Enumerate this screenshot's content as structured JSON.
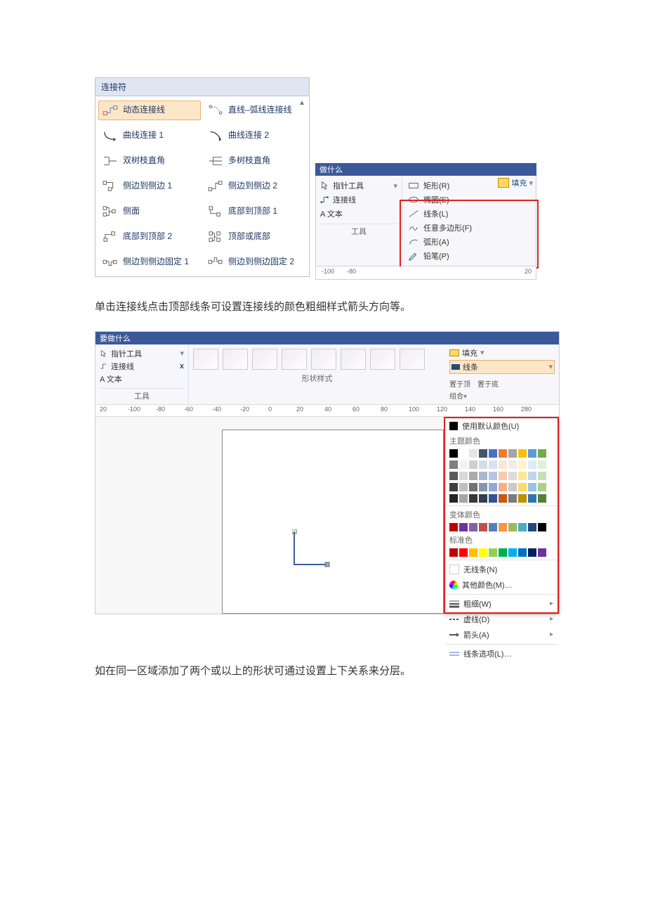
{
  "connectors": {
    "title": "连接符",
    "items": [
      {
        "label": "动态连接线",
        "name": "connector-dynamic",
        "selected": true
      },
      {
        "label": "直线–弧线连接线",
        "name": "connector-line-arc"
      },
      {
        "label": "曲线连接 1",
        "name": "connector-curve-1"
      },
      {
        "label": "曲线连接 2",
        "name": "connector-curve-2"
      },
      {
        "label": "双树枝直角",
        "name": "connector-double-branch"
      },
      {
        "label": "多树枝直角",
        "name": "connector-multi-branch"
      },
      {
        "label": "侧边到侧边 1",
        "name": "connector-side-to-side-1"
      },
      {
        "label": "侧边到侧边 2",
        "name": "connector-side-to-side-2"
      },
      {
        "label": "侧面",
        "name": "connector-side"
      },
      {
        "label": "底部到顶部 1",
        "name": "connector-bottom-top-1"
      },
      {
        "label": "底部到顶部 2",
        "name": "connector-bottom-top-2"
      },
      {
        "label": "顶部或底部",
        "name": "connector-top-or-bottom"
      },
      {
        "label": "侧边到侧边固定 1",
        "name": "connector-side-fixed-1"
      },
      {
        "label": "侧边到侧边固定 2",
        "name": "connector-side-fixed-2"
      }
    ]
  },
  "shapes_dropdown": {
    "bar_hint": "做什么",
    "tools": {
      "pointer": "指针工具",
      "connector": "连接线",
      "text": "A 文本",
      "group_label": "工具"
    },
    "fill_label": "填充",
    "options": [
      {
        "label": "矩形(R)",
        "name": "shape-rectangle"
      },
      {
        "label": "椭圆(E)",
        "name": "shape-ellipse"
      },
      {
        "label": "线条(L)",
        "name": "shape-line"
      },
      {
        "label": "任意多边形(F)",
        "name": "shape-freeform"
      },
      {
        "label": "弧形(A)",
        "name": "shape-arc"
      },
      {
        "label": "铅笔(P)",
        "name": "shape-pencil"
      }
    ],
    "ruler_values": [
      "-100",
      "-80",
      "",
      "20"
    ]
  },
  "paragraph1": "单击连接线点击顶部线条可设置连接线的颜色粗细样式箭头方向等。",
  "shot3": {
    "bar_hint": "要做什么",
    "tools": {
      "pointer": "指针工具",
      "connector": "连接线",
      "text": "A 文本",
      "close_icon": "x",
      "group_label": "工具"
    },
    "style_group_label": "形状样式",
    "ruler_values": [
      "20",
      "-100",
      "-80",
      "-60",
      "-40",
      "-20",
      "0",
      "20",
      "40",
      "60",
      "80",
      "100",
      "120",
      "140",
      "160",
      "280"
    ],
    "right": {
      "fill": "填充",
      "line": "线条",
      "arrange_front": "置于顶",
      "arrange_back": "置于底",
      "group": "组合"
    }
  },
  "line_popup": {
    "use_default": "使用默认颜色(U)",
    "theme_label": "主题颜色",
    "variant_label": "变体颜色",
    "standard_label": "标准色",
    "no_line": "无线条(N)",
    "more_colors": "其他颜色(M)…",
    "weight": "粗细(W)",
    "dashes": "虚线(D)",
    "arrows": "箭头(A)",
    "line_options": "线条选项(L)…",
    "theme_colors_row1": [
      "#000000",
      "#ffffff",
      "#e7e6e6",
      "#44546a",
      "#4472c4",
      "#ed7d31",
      "#a5a5a5",
      "#ffc000",
      "#5b9bd5",
      "#70ad47"
    ],
    "theme_shades": [
      [
        "#7f7f7f",
        "#f2f2f2",
        "#d0cece",
        "#d6dce5",
        "#d9e1f2",
        "#fce4d6",
        "#ededed",
        "#fff2cc",
        "#ddebf7",
        "#e2efda"
      ],
      [
        "#595959",
        "#d9d9d9",
        "#aeaaaa",
        "#adb9ca",
        "#b4c6e7",
        "#f8cbad",
        "#dbdbdb",
        "#ffe699",
        "#bdd7ee",
        "#c6e0b4"
      ],
      [
        "#404040",
        "#bfbfbf",
        "#757171",
        "#8497b0",
        "#8ea9db",
        "#f4b084",
        "#c9c9c9",
        "#ffd966",
        "#9bc2e6",
        "#a9d08e"
      ],
      [
        "#262626",
        "#a6a6a6",
        "#3a3838",
        "#333f4f",
        "#305496",
        "#c65911",
        "#7b7b7b",
        "#bf8f00",
        "#2f75b5",
        "#548235"
      ]
    ],
    "variant_colors": [
      "#c00000",
      "#7030a0",
      "#8064a2",
      "#c0504d",
      "#4f81bd",
      "#f79646",
      "#9bbb59",
      "#4bacc6",
      "#1f497d",
      "#000000"
    ],
    "standard_colors": [
      "#c00000",
      "#ff0000",
      "#ffc000",
      "#ffff00",
      "#92d050",
      "#00b050",
      "#00b0f0",
      "#0070c0",
      "#002060",
      "#7030a0"
    ]
  },
  "paragraph2": "如在同一区域添加了两个或以上的形状可通过设置上下关系来分层。"
}
